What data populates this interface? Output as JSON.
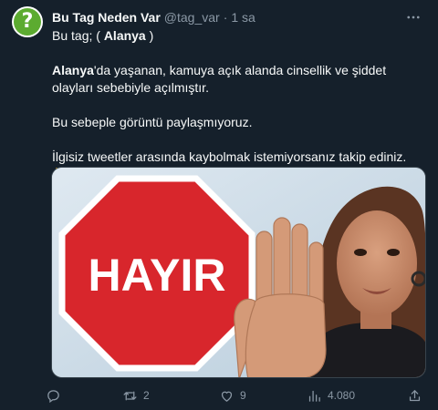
{
  "tweet": {
    "display_name": "Bu Tag Neden Var",
    "handle": "@tag_var",
    "time": "1 sa",
    "line1_prefix": "Bu tag; ( ",
    "line1_tag": "Alanya",
    "line1_suffix": " )",
    "line2_bold": "Alanya",
    "line2_rest": "'da yaşanan, kamuya açık alanda cinsellik ve şiddet olayları sebebiyle açılmıştır.",
    "line3": "Bu sebeple görüntü paylaşmıyoruz.",
    "line4": "İlgisiz tweetler arasında kaybolmak istemiyorsanız takip ediniz.",
    "line5_emoji": "👇"
  },
  "avatar": {
    "glyph": "?",
    "color": "#5cab30"
  },
  "media": {
    "sign_text": "HAYIR"
  },
  "actions": {
    "reply_count": "",
    "retweet_count": "2",
    "like_count": "9",
    "views_count": "4.080"
  },
  "icons": {
    "more": "more-horizontal-icon",
    "reply": "reply-icon",
    "retweet": "retweet-icon",
    "like": "heart-icon",
    "views": "views-icon",
    "share": "share-icon"
  },
  "colors": {
    "background": "#15202b",
    "secondary_text": "#8b98a5",
    "stop_sign_red": "#d8262c"
  }
}
